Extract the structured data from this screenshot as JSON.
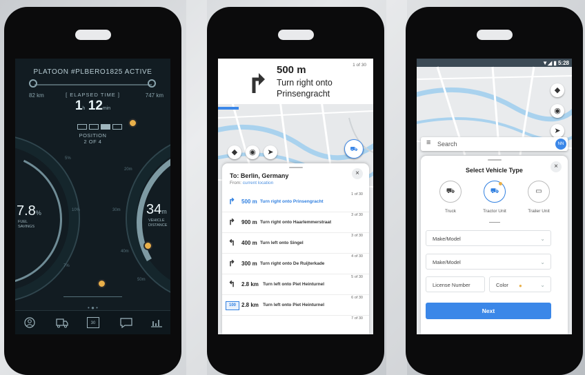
{
  "phone1": {
    "title": "PLATOON #PLBERO1825 ACTIVE",
    "km_left": "82 km",
    "km_right": "747 km",
    "elapsed_label": "ELAPSED TIME",
    "elapsed_h": "1",
    "elapsed_h_unit": "h",
    "elapsed_m": "12",
    "elapsed_m_unit": "min",
    "position_label": "POSITION",
    "position_value": "2 OF 4",
    "fuel_value": "7.8",
    "fuel_unit": "%",
    "fuel_caption_1": "FUEL",
    "fuel_caption_2": "SAVINGS",
    "left_ticks": [
      "5%",
      "10%",
      "7%"
    ],
    "distance_value": "34",
    "distance_unit": "m",
    "distance_caption_1": "VEHICLE",
    "distance_caption_2": "DISTANCE",
    "right_ticks": [
      "20m",
      "30m",
      "40m",
      "50m"
    ],
    "pager": "• ● •",
    "nav_icons": [
      "user-icon",
      "truck-icon",
      "calendar-icon",
      "chat-icon",
      "chart-icon"
    ],
    "calendar_day": "30",
    "accent_color": "#e9b04a"
  },
  "phone2": {
    "distance": "500 m",
    "instruction_line1": "Turn right onto",
    "instruction_line2": "Prinsengracht",
    "counter": "1 of 30",
    "to_label": "To: Berlin, Germany",
    "from_label": "From:",
    "from_value": "current location",
    "close": "×",
    "steps": [
      {
        "dir": "right",
        "distance": "500 m",
        "text": "Turn right onto Prinsengracht",
        "count": "1 of 30",
        "active": true
      },
      {
        "dir": "right",
        "distance": "900 m",
        "text": "Turn right onto Haarlemmerstraat",
        "count": "3 of 30"
      },
      {
        "dir": "left",
        "distance": "400 m",
        "text": "Turn left onto Singel",
        "count": "3 of 30"
      },
      {
        "dir": "right",
        "distance": "300 m",
        "text": "Turn right onto De Ruijterkade",
        "count": "4 of 30"
      },
      {
        "dir": "left",
        "distance": "2.8 km",
        "text": "Turn left onto Piet Heinturnel",
        "count": "5 of 30"
      },
      {
        "dir": "road",
        "badge": "100",
        "distance": "2.8 km",
        "text": "Turn left onto Piet Heinturnel",
        "count": "6 of 30"
      },
      {
        "dir": "none",
        "distance": "",
        "text": "",
        "count": "7 of 30"
      }
    ],
    "accent_color": "#2f7fe0"
  },
  "phone3": {
    "status_time": "5:28",
    "search_placeholder": "Search",
    "avatar_initials": "NN",
    "sheet_title": "Select Vehicle Type",
    "close": "×",
    "vehicle_types": [
      {
        "label": "Truck",
        "icon": "truck-icon",
        "selected": false
      },
      {
        "label": "Tractor Unit",
        "icon": "tractor-unit-icon",
        "selected": true
      },
      {
        "label": "Trailer Unit",
        "icon": "trailer-unit-icon",
        "selected": false
      }
    ],
    "make_model_1": "Make/Model",
    "make_model_2": "Make/Model",
    "license_placeholder": "License Number",
    "color_label": "Color",
    "next_label": "Next",
    "accent_color": "#3b87e8"
  }
}
